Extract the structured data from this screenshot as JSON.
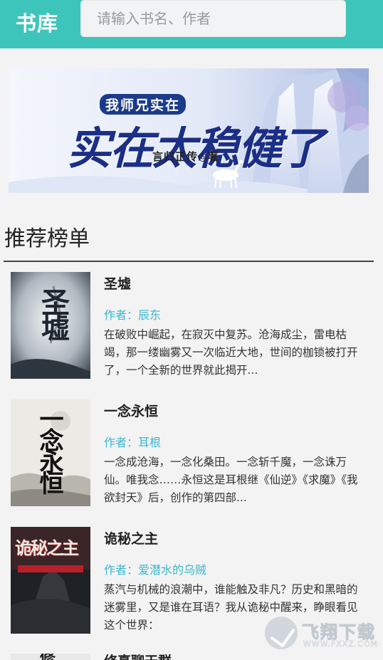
{
  "header": {
    "brand": "书库",
    "search_placeholder": "请输入书名、作者"
  },
  "banner": {
    "line1": "我师兄实在",
    "line2": "实在太稳健了",
    "author": "言归正传◎著"
  },
  "section": {
    "title": "推荐榜单"
  },
  "books": [
    {
      "title": "圣墟",
      "author": "作者：辰东",
      "desc": "在破败中崛起，在寂灭中复苏。沧海成尘，雷电枯竭，那一缕幽雾又一次临近大地，世间的枷锁被打开了，一个全新的世界就此揭开...",
      "cover_title": "圣墟"
    },
    {
      "title": "一念永恒",
      "author": "作者：耳根",
      "desc": "一念成沧海，一念化桑田。一念斩千魔，一念诛万仙。唯我念……永恒这是耳根继《仙逆》《求魔》《我欲封天》后，创作的第四部...",
      "cover_title": "一念永恒"
    },
    {
      "title": "诡秘之主",
      "author": "作者：爱潜水的乌贼",
      "desc": "蒸汽与机械的浪潮中，谁能触及非凡？历史和黑暗的迷雾里，又是谁在耳语？我从诡秘中醒来，睁眼看见这个世界：",
      "cover_title": "诡秘之主"
    },
    {
      "title": "修真聊天群",
      "author": "",
      "desc": "",
      "cover_title": "修"
    }
  ],
  "watermark": {
    "text": "飞翔下载",
    "url": "WWW.FXXZ.COM"
  }
}
